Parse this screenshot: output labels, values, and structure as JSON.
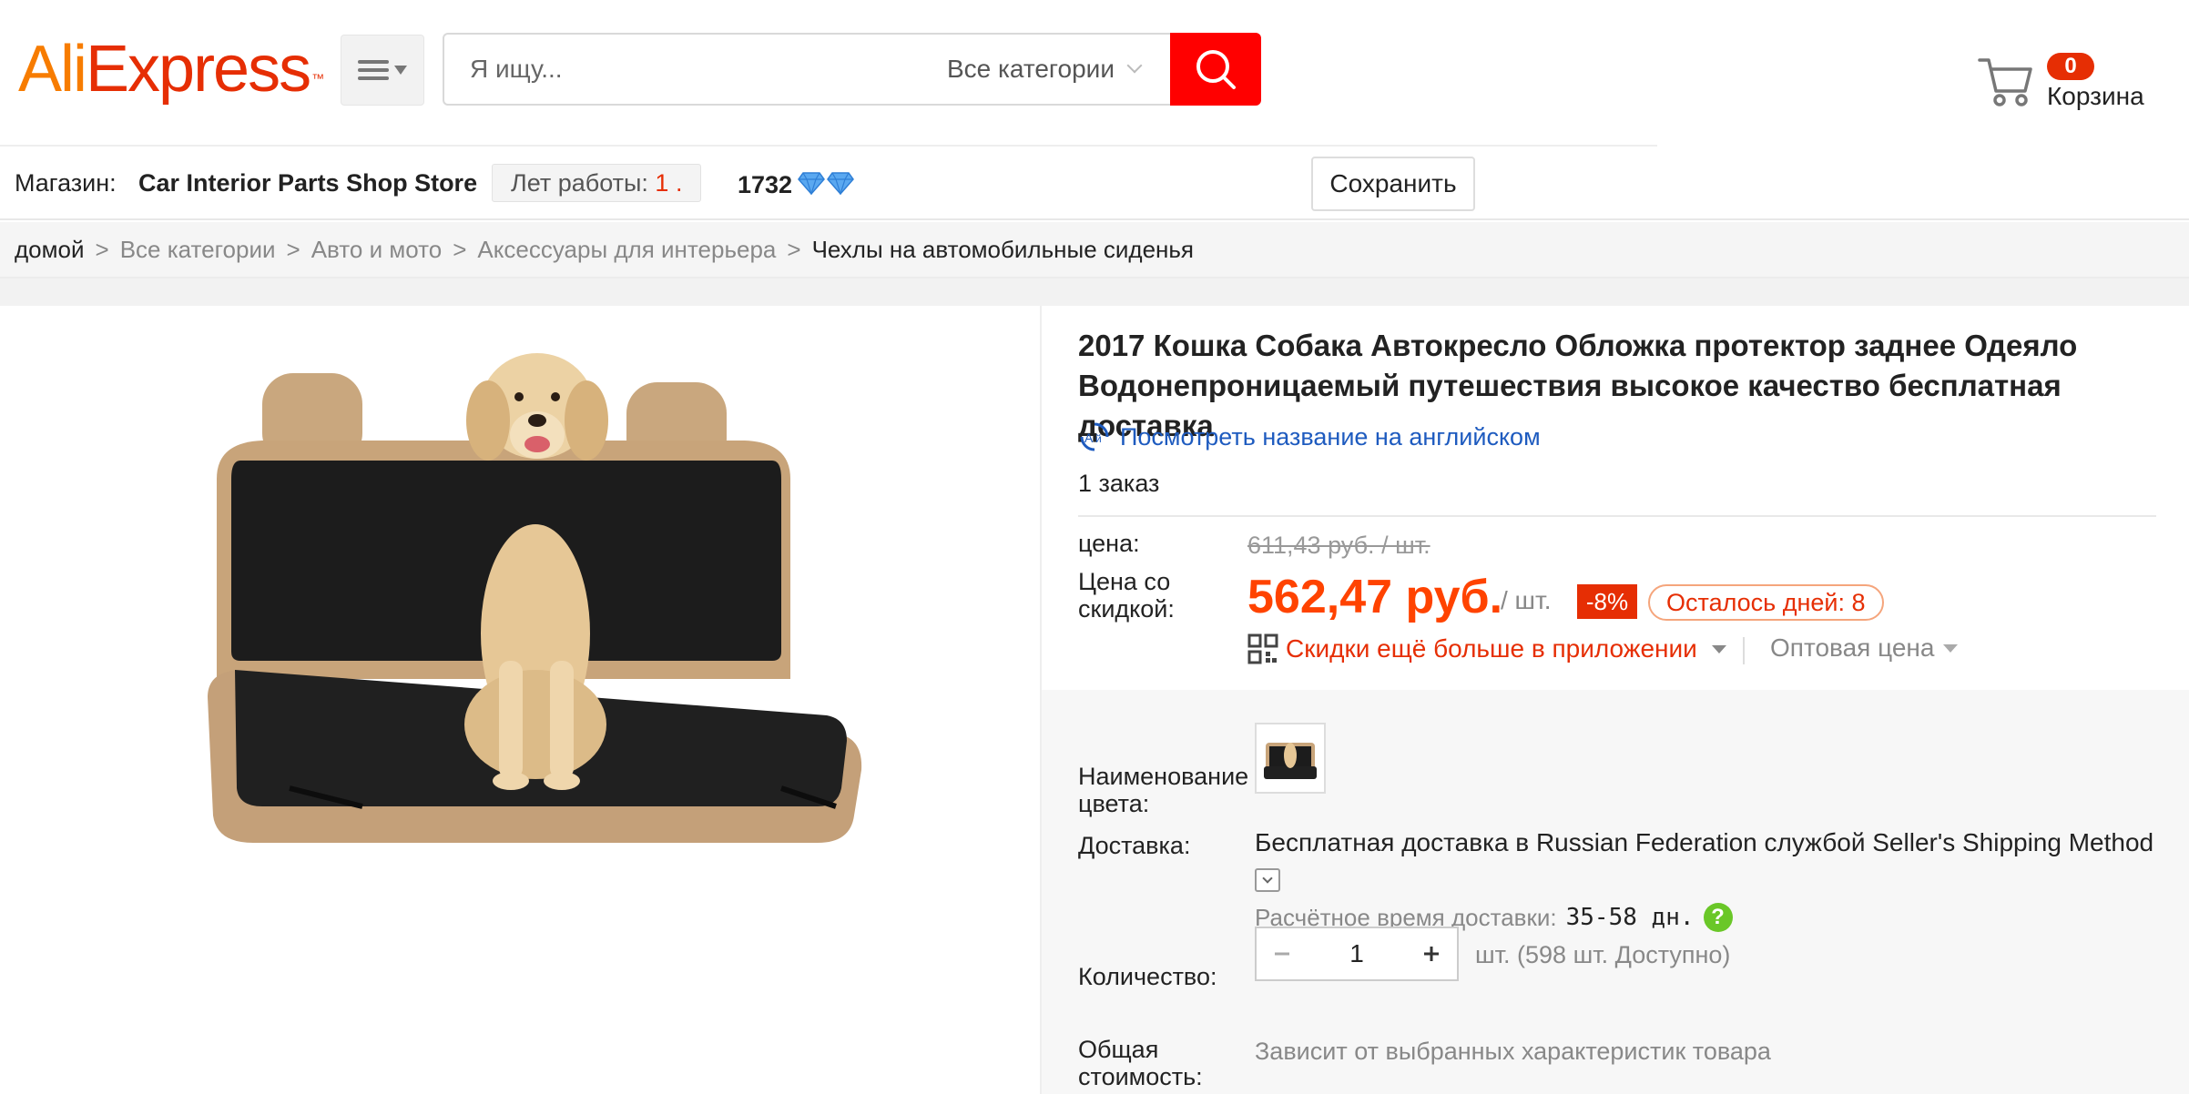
{
  "header": {
    "logo_ali": "Ali",
    "logo_express": "Express",
    "logo_tm": "™",
    "search_placeholder": "Я ищу...",
    "search_category": "Все категории",
    "cart_count": "0",
    "cart_label": "Корзина"
  },
  "store": {
    "label": "Магазин:",
    "name": "Car Interior Parts Shop Store",
    "years_label": "Лет работы:",
    "years_value": "1 .",
    "score": "1732",
    "save_label": "Сохранить"
  },
  "breadcrumb": [
    "домой",
    "Все категории",
    "Авто и мото",
    "Аксессуары для интерьера",
    "Чехлы на автомобильные сиденья"
  ],
  "product": {
    "title": "2017 Кошка Собака Автокресло Обложка протектор заднее Одеяло Водонепроницаемый путешествия высокое качество бесплатная доставка",
    "translate_link": "Посмотреть название на английском",
    "orders": "1 заказ",
    "price_label": "цена:",
    "old_price": "611,43 руб. / шт.",
    "discount_price_label": "Цена со скидкой:",
    "new_price": "562,47 руб.",
    "per_unit": "/ шт.",
    "discount_badge": "-8%",
    "days_left": "Осталось дней: 8",
    "app_discount": "Скидки ещё больше в приложении",
    "wholesale": "Оптовая цена"
  },
  "options": {
    "color_label": "Наименование цвета:",
    "shipping_label": "Доставка:",
    "shipping_free": "Бесплатная доставка в",
    "shipping_dest": "Russian Federation службой Seller's Shipping Method",
    "eta_label": "Расчётное время доставки:",
    "eta_value": "35-58 дн.",
    "help": "?",
    "quantity_label": "Количество:",
    "quantity_value": "1",
    "quantity_note": "шт. (598 шт. Доступно)",
    "total_label": "Общая стоимость:",
    "total_note": "Зависит от выбранных характеристик товара"
  },
  "colors": {
    "brand_red": "#e62e04",
    "brand_orange": "#f77c00",
    "price_orange": "#ff4300",
    "link_blue": "#1e5bbf"
  },
  "icons": [
    "menu-icon",
    "search-icon",
    "cart-icon",
    "diamond-icon",
    "translate-icon",
    "qr-code-icon",
    "help-icon",
    "chevron-down-icon"
  ]
}
